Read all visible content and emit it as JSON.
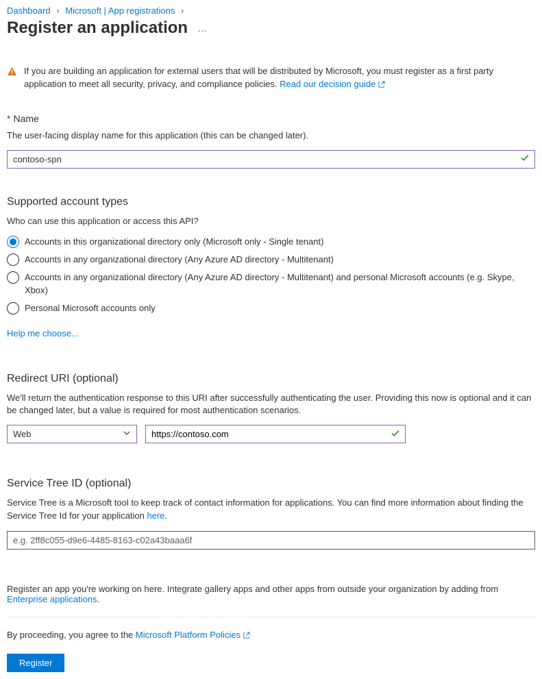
{
  "breadcrumb": {
    "item1": "Dashboard",
    "item2": "Microsoft | App registrations"
  },
  "page_title": "Register an application",
  "warning": {
    "text": "If you are building an application for external users that will be distributed by Microsoft, you must register as a first party application to meet all security, privacy, and compliance policies. ",
    "link": "Read our decision guide"
  },
  "name": {
    "label": "Name",
    "helper": "The user-facing display name for this application (this can be changed later).",
    "value": "contoso-spn"
  },
  "account_types": {
    "heading": "Supported account types",
    "question": "Who can use this application or access this API?",
    "options": [
      "Accounts in this organizational directory only (Microsoft only - Single tenant)",
      "Accounts in any organizational directory (Any Azure AD directory - Multitenant)",
      "Accounts in any organizational directory (Any Azure AD directory - Multitenant) and personal Microsoft accounts (e.g. Skype, Xbox)",
      "Personal Microsoft accounts only"
    ],
    "help_link": "Help me choose..."
  },
  "redirect": {
    "heading": "Redirect URI (optional)",
    "helper": "We'll return the authentication response to this URI after successfully authenticating the user. Providing this now is optional and it can be changed later, but a value is required for most authentication scenarios.",
    "platform": "Web",
    "url": "https://contoso.com"
  },
  "service_tree": {
    "heading": "Service Tree ID (optional)",
    "helper_pre": "Service Tree is a Microsoft tool to keep track of contact information for applications. You can find more information about finding the Service Tree Id for your application ",
    "helper_link": "here",
    "helper_post": ".",
    "placeholder": "e.g. 2ff8c055-d9e6-4485-8163-c02a43baaa6f"
  },
  "footer": {
    "note_pre": "Register an app you're working on here. Integrate gallery apps and other apps from outside your organization by adding from ",
    "note_link": "Enterprise applications",
    "note_post": ".",
    "agree_pre": "By proceeding, you agree to the ",
    "agree_link": "Microsoft Platform Policies",
    "register": "Register"
  }
}
